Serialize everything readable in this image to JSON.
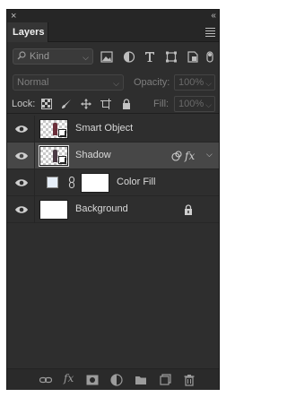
{
  "window": {
    "close_glyph": "×",
    "collapse_glyph": "‹‹"
  },
  "panel": {
    "tab_label": "Layers"
  },
  "filter": {
    "kind_label": "Kind"
  },
  "blend": {
    "mode": "Normal",
    "opacity_label": "Opacity:",
    "opacity_value": "100%"
  },
  "lock": {
    "label": "Lock:",
    "fill_label": "Fill:",
    "fill_value": "100%"
  },
  "layers": [
    {
      "name": "Smart Object",
      "visible": true,
      "selected": false,
      "type": "smart-object"
    },
    {
      "name": "Shadow",
      "visible": true,
      "selected": true,
      "type": "smart-object",
      "fx": "fx"
    },
    {
      "name": "Color Fill",
      "visible": true,
      "selected": false,
      "type": "solid-color",
      "color": "#e6eef8"
    },
    {
      "name": "Background",
      "visible": true,
      "selected": false,
      "type": "background",
      "locked": true
    }
  ],
  "bottom_icons": [
    "link-layers-icon",
    "add-style-icon",
    "add-mask-icon",
    "adjustment-layer-icon",
    "new-group-icon",
    "new-layer-icon",
    "delete-layer-icon"
  ],
  "colors": {
    "panel_bg": "#2e2e2e",
    "selected_row": "#474747",
    "text": "#d9d9d9"
  }
}
